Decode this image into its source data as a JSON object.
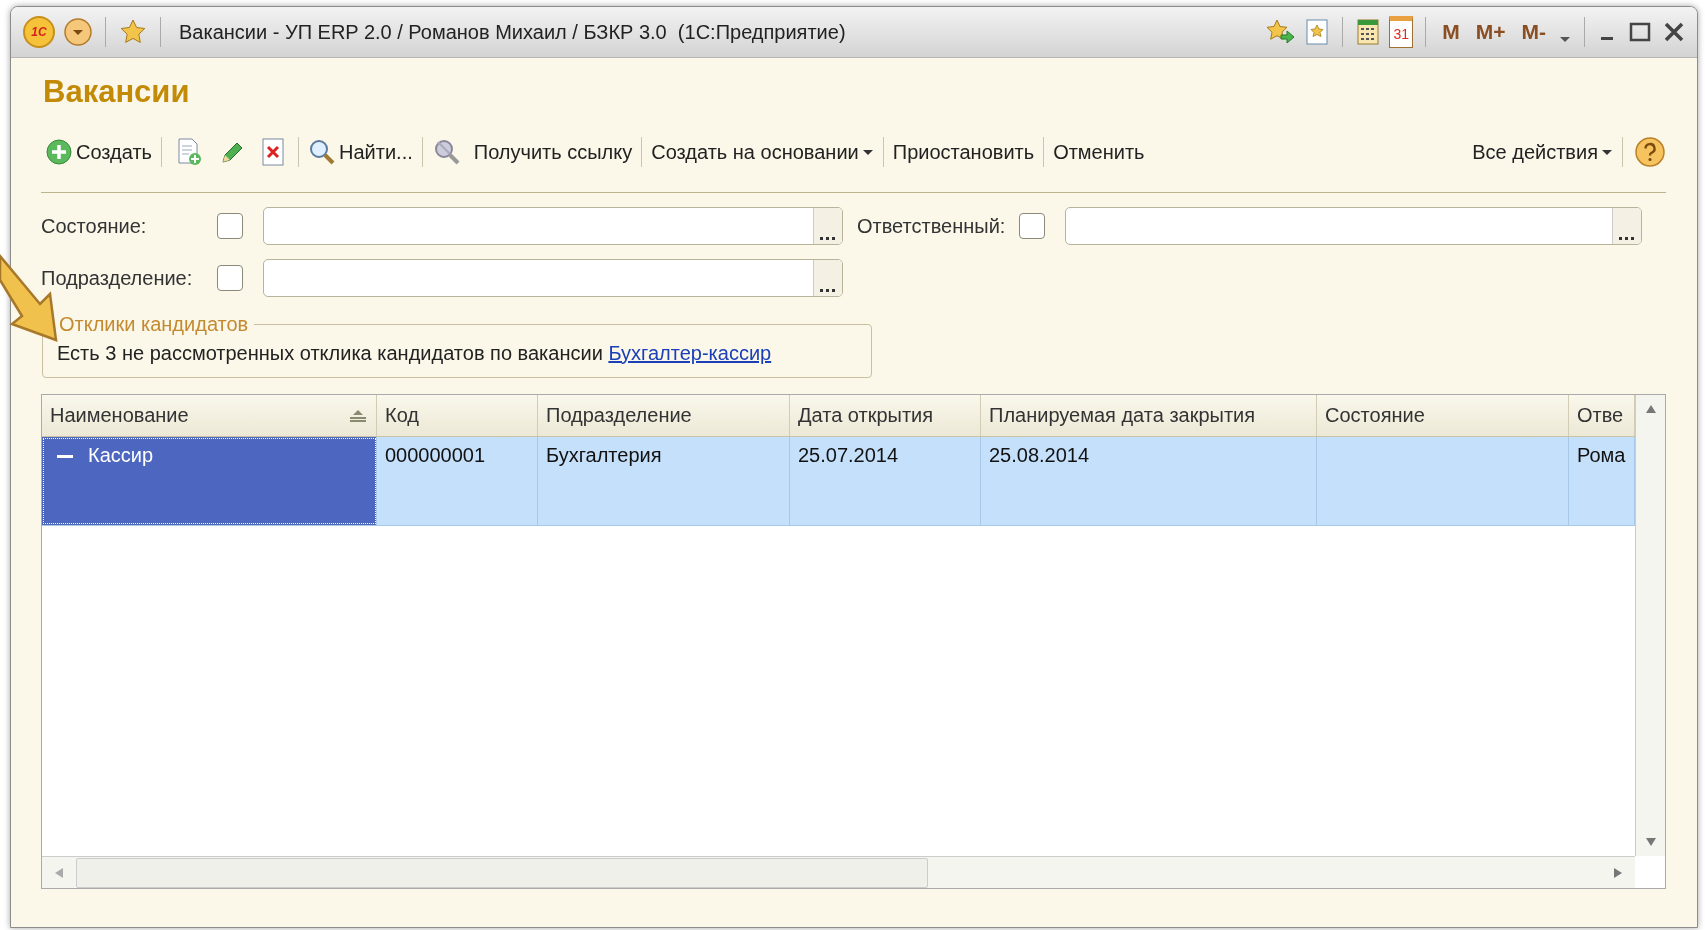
{
  "window": {
    "title": "Вакансии - УП ERP 2.0 / Романов Михаил / БЗКР 3.0  (1С:Предприятие)",
    "logo_text": "1С",
    "calendar_day": "31",
    "memory_buttons": [
      "M",
      "M+",
      "M-"
    ]
  },
  "heading": "Вакансии",
  "toolbar": [
    {
      "kind": "create",
      "label": "Создать"
    },
    {
      "kind": "separator"
    },
    {
      "kind": "copy"
    },
    {
      "kind": "edit"
    },
    {
      "kind": "delete"
    },
    {
      "kind": "separator"
    },
    {
      "kind": "find",
      "label": "Найти..."
    },
    {
      "kind": "separator"
    },
    {
      "kind": "link",
      "label": "Получить ссылку"
    },
    {
      "kind": "separator"
    },
    {
      "kind": "menu",
      "label": "Создать на основании"
    },
    {
      "kind": "separator"
    },
    {
      "kind": "text",
      "label": "Приостановить"
    },
    {
      "kind": "separator"
    },
    {
      "kind": "text",
      "label": "Отменить"
    }
  ],
  "all_actions": {
    "label": "Все действия"
  },
  "filter_rows": [
    [
      {
        "label": "Состояние:",
        "checked": false
      },
      {
        "label": "Ответственный:",
        "checked": false
      }
    ],
    [
      {
        "label": "Подразделение:",
        "checked": false
      }
    ]
  ],
  "responses": {
    "title": "Отклики кандидатов",
    "text": "Есть 3 не рассмотренных отклика кандидатов по вакансии",
    "link": "Бухгалтер-кассир"
  },
  "table": {
    "columns": [
      {
        "label": "Наименование",
        "sorted": true
      },
      {
        "label": "Код",
        "sorted": false
      },
      {
        "label": "Подразделение",
        "sorted": false
      },
      {
        "label": "Дата открытия",
        "sorted": false
      },
      {
        "label": "Планируемая дата закрытия",
        "sorted": false
      },
      {
        "label": "Состояние",
        "sorted": false
      },
      {
        "label": "Отве",
        "sorted": false
      }
    ],
    "rows": [
      {
        "selected": true,
        "expanded": true,
        "cells": [
          "Кассир",
          "000000001",
          "Бухгалтерия",
          "25.07.2014",
          "25.08.2014",
          "",
          "Рома"
        ]
      }
    ]
  }
}
